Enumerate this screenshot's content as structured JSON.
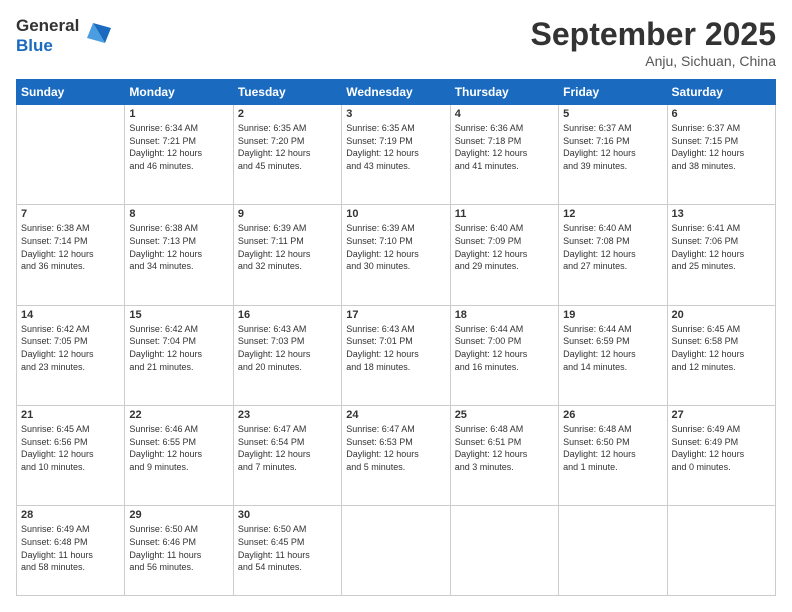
{
  "header": {
    "logo_line1": "General",
    "logo_line2": "Blue",
    "month": "September 2025",
    "location": "Anju, Sichuan, China"
  },
  "weekdays": [
    "Sunday",
    "Monday",
    "Tuesday",
    "Wednesday",
    "Thursday",
    "Friday",
    "Saturday"
  ],
  "weeks": [
    [
      {
        "day": "",
        "info": ""
      },
      {
        "day": "1",
        "info": "Sunrise: 6:34 AM\nSunset: 7:21 PM\nDaylight: 12 hours\nand 46 minutes."
      },
      {
        "day": "2",
        "info": "Sunrise: 6:35 AM\nSunset: 7:20 PM\nDaylight: 12 hours\nand 45 minutes."
      },
      {
        "day": "3",
        "info": "Sunrise: 6:35 AM\nSunset: 7:19 PM\nDaylight: 12 hours\nand 43 minutes."
      },
      {
        "day": "4",
        "info": "Sunrise: 6:36 AM\nSunset: 7:18 PM\nDaylight: 12 hours\nand 41 minutes."
      },
      {
        "day": "5",
        "info": "Sunrise: 6:37 AM\nSunset: 7:16 PM\nDaylight: 12 hours\nand 39 minutes."
      },
      {
        "day": "6",
        "info": "Sunrise: 6:37 AM\nSunset: 7:15 PM\nDaylight: 12 hours\nand 38 minutes."
      }
    ],
    [
      {
        "day": "7",
        "info": "Sunrise: 6:38 AM\nSunset: 7:14 PM\nDaylight: 12 hours\nand 36 minutes."
      },
      {
        "day": "8",
        "info": "Sunrise: 6:38 AM\nSunset: 7:13 PM\nDaylight: 12 hours\nand 34 minutes."
      },
      {
        "day": "9",
        "info": "Sunrise: 6:39 AM\nSunset: 7:11 PM\nDaylight: 12 hours\nand 32 minutes."
      },
      {
        "day": "10",
        "info": "Sunrise: 6:39 AM\nSunset: 7:10 PM\nDaylight: 12 hours\nand 30 minutes."
      },
      {
        "day": "11",
        "info": "Sunrise: 6:40 AM\nSunset: 7:09 PM\nDaylight: 12 hours\nand 29 minutes."
      },
      {
        "day": "12",
        "info": "Sunrise: 6:40 AM\nSunset: 7:08 PM\nDaylight: 12 hours\nand 27 minutes."
      },
      {
        "day": "13",
        "info": "Sunrise: 6:41 AM\nSunset: 7:06 PM\nDaylight: 12 hours\nand 25 minutes."
      }
    ],
    [
      {
        "day": "14",
        "info": "Sunrise: 6:42 AM\nSunset: 7:05 PM\nDaylight: 12 hours\nand 23 minutes."
      },
      {
        "day": "15",
        "info": "Sunrise: 6:42 AM\nSunset: 7:04 PM\nDaylight: 12 hours\nand 21 minutes."
      },
      {
        "day": "16",
        "info": "Sunrise: 6:43 AM\nSunset: 7:03 PM\nDaylight: 12 hours\nand 20 minutes."
      },
      {
        "day": "17",
        "info": "Sunrise: 6:43 AM\nSunset: 7:01 PM\nDaylight: 12 hours\nand 18 minutes."
      },
      {
        "day": "18",
        "info": "Sunrise: 6:44 AM\nSunset: 7:00 PM\nDaylight: 12 hours\nand 16 minutes."
      },
      {
        "day": "19",
        "info": "Sunrise: 6:44 AM\nSunset: 6:59 PM\nDaylight: 12 hours\nand 14 minutes."
      },
      {
        "day": "20",
        "info": "Sunrise: 6:45 AM\nSunset: 6:58 PM\nDaylight: 12 hours\nand 12 minutes."
      }
    ],
    [
      {
        "day": "21",
        "info": "Sunrise: 6:45 AM\nSunset: 6:56 PM\nDaylight: 12 hours\nand 10 minutes."
      },
      {
        "day": "22",
        "info": "Sunrise: 6:46 AM\nSunset: 6:55 PM\nDaylight: 12 hours\nand 9 minutes."
      },
      {
        "day": "23",
        "info": "Sunrise: 6:47 AM\nSunset: 6:54 PM\nDaylight: 12 hours\nand 7 minutes."
      },
      {
        "day": "24",
        "info": "Sunrise: 6:47 AM\nSunset: 6:53 PM\nDaylight: 12 hours\nand 5 minutes."
      },
      {
        "day": "25",
        "info": "Sunrise: 6:48 AM\nSunset: 6:51 PM\nDaylight: 12 hours\nand 3 minutes."
      },
      {
        "day": "26",
        "info": "Sunrise: 6:48 AM\nSunset: 6:50 PM\nDaylight: 12 hours\nand 1 minute."
      },
      {
        "day": "27",
        "info": "Sunrise: 6:49 AM\nSunset: 6:49 PM\nDaylight: 12 hours\nand 0 minutes."
      }
    ],
    [
      {
        "day": "28",
        "info": "Sunrise: 6:49 AM\nSunset: 6:48 PM\nDaylight: 11 hours\nand 58 minutes."
      },
      {
        "day": "29",
        "info": "Sunrise: 6:50 AM\nSunset: 6:46 PM\nDaylight: 11 hours\nand 56 minutes."
      },
      {
        "day": "30",
        "info": "Sunrise: 6:50 AM\nSunset: 6:45 PM\nDaylight: 11 hours\nand 54 minutes."
      },
      {
        "day": "",
        "info": ""
      },
      {
        "day": "",
        "info": ""
      },
      {
        "day": "",
        "info": ""
      },
      {
        "day": "",
        "info": ""
      }
    ]
  ]
}
